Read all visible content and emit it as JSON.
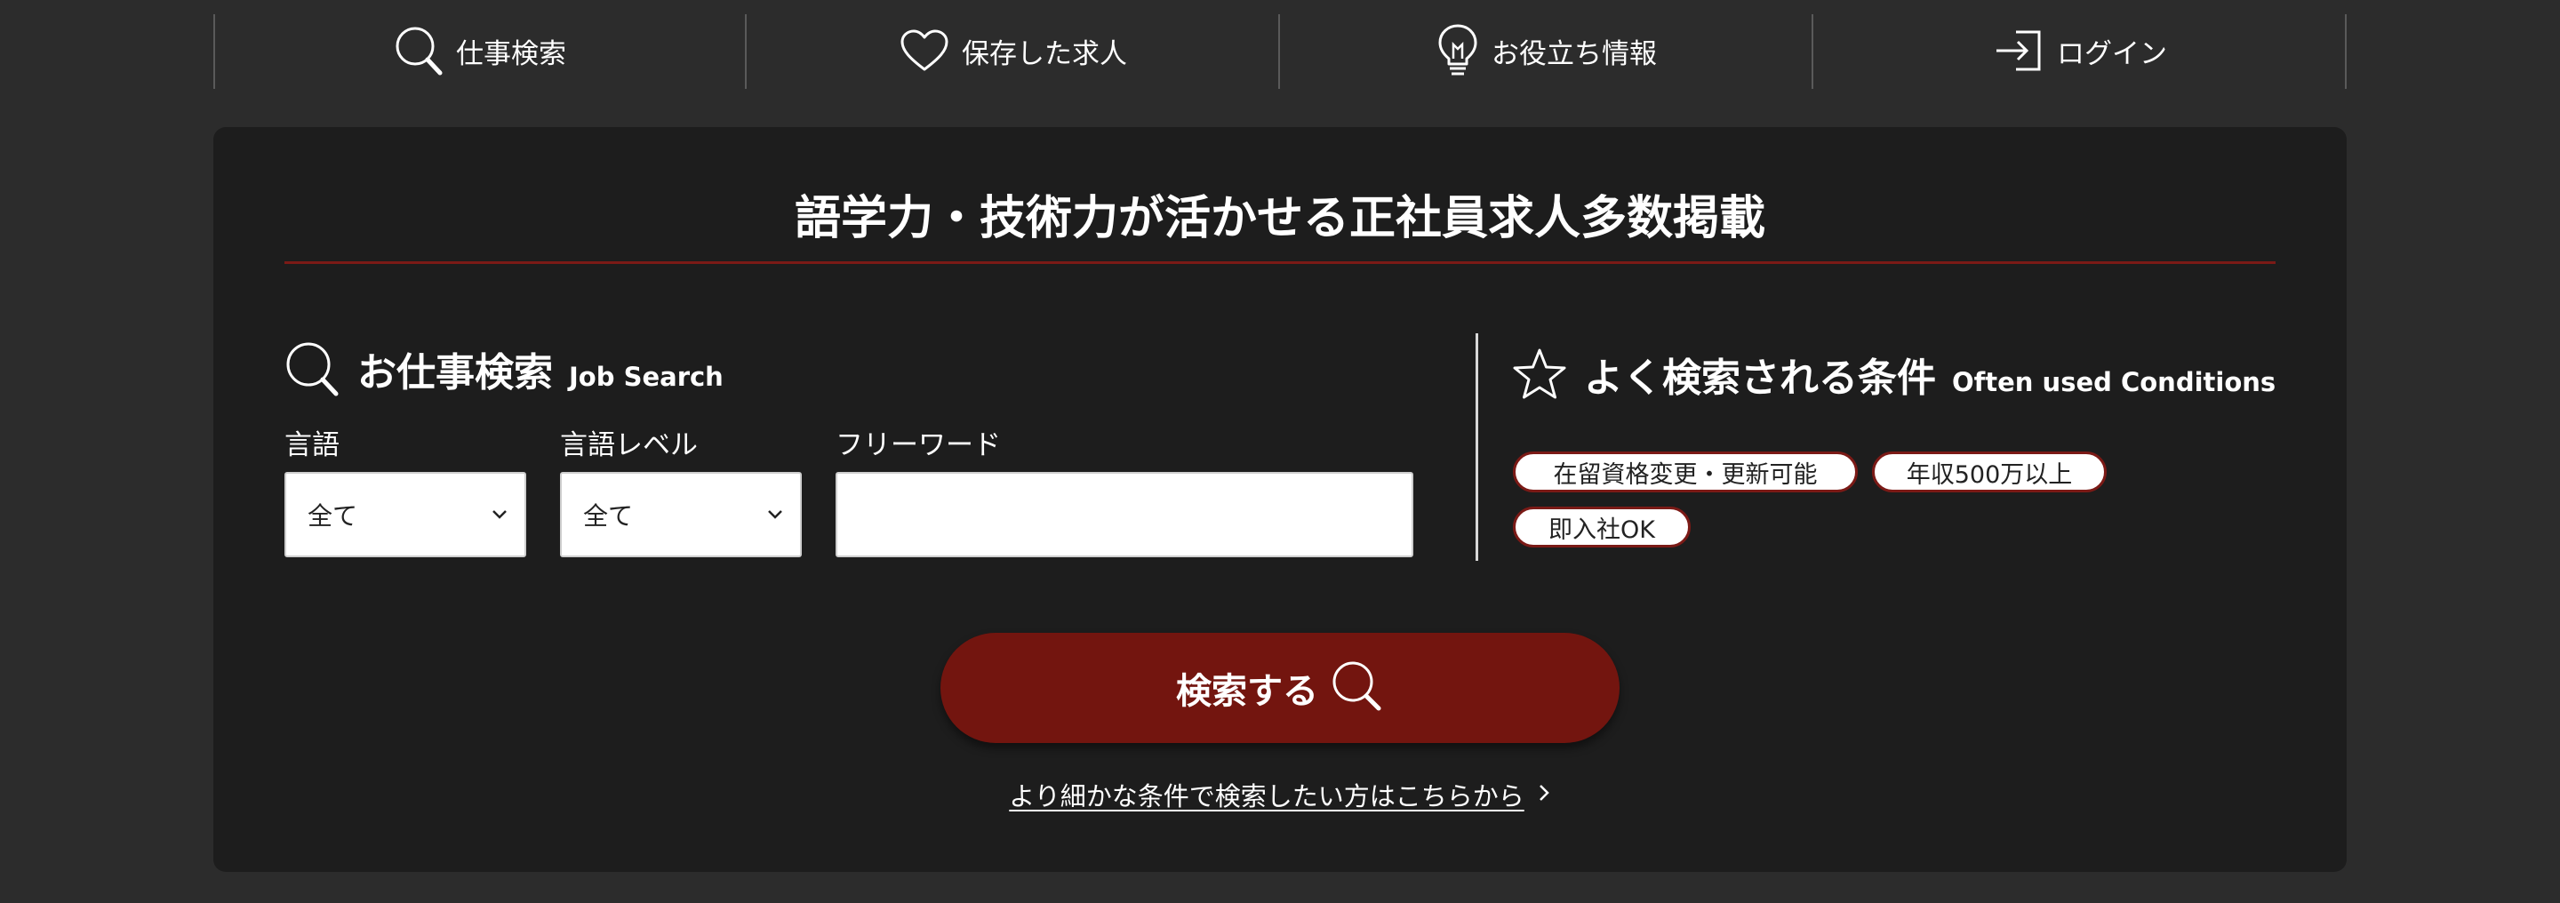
{
  "nav": {
    "items": [
      {
        "label": "仕事検索",
        "icon": "search-icon"
      },
      {
        "label": "保存した求人",
        "icon": "heart-icon"
      },
      {
        "label": "お役立ち情報",
        "icon": "lightbulb-icon"
      },
      {
        "label": "ログイン",
        "icon": "login-icon"
      }
    ]
  },
  "card": {
    "title": "語学力・技術力が活かせる正社員求人多数掲載"
  },
  "job_search": {
    "heading": "お仕事検索",
    "heading_en": "Job Search",
    "language": {
      "label": "言語",
      "value": "全て"
    },
    "level": {
      "label": "言語レベル",
      "value": "全て"
    },
    "freeword": {
      "label": "フリーワード",
      "value": ""
    }
  },
  "conditions": {
    "heading": "よく検索される条件",
    "heading_en": "Often used Conditions",
    "chips": [
      "在留資格変更・更新可能",
      "年収500万以上",
      "即入社OK"
    ]
  },
  "search_button": {
    "label": "検索する"
  },
  "advanced_link": {
    "label": "より細かな条件で検索したい方はこちらから"
  },
  "colors": {
    "page_bg": "#2c2c2c",
    "card_bg": "#1d1d1d",
    "accent": "#73150f"
  }
}
